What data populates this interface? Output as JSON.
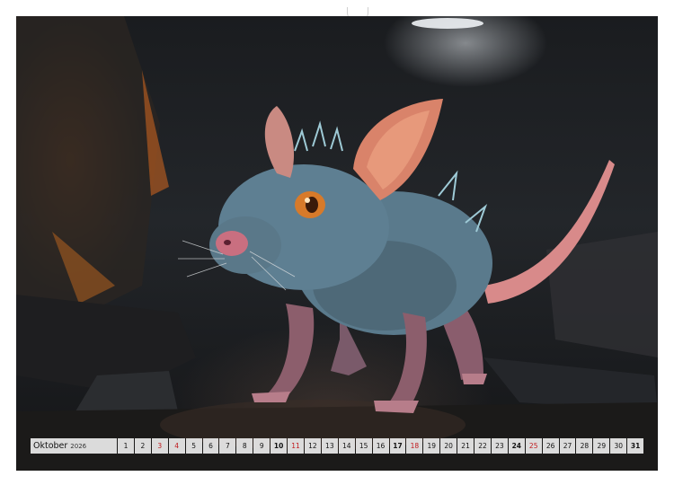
{
  "calendar": {
    "month": "Oktober",
    "year": "2026",
    "days": [
      {
        "d": "1",
        "type": "normal"
      },
      {
        "d": "2",
        "type": "normal"
      },
      {
        "d": "3",
        "type": "holiday"
      },
      {
        "d": "4",
        "type": "holiday"
      },
      {
        "d": "5",
        "type": "normal"
      },
      {
        "d": "6",
        "type": "normal"
      },
      {
        "d": "7",
        "type": "normal"
      },
      {
        "d": "8",
        "type": "normal"
      },
      {
        "d": "9",
        "type": "normal"
      },
      {
        "d": "10",
        "type": "wkend"
      },
      {
        "d": "11",
        "type": "holiday"
      },
      {
        "d": "12",
        "type": "normal"
      },
      {
        "d": "13",
        "type": "normal"
      },
      {
        "d": "14",
        "type": "normal"
      },
      {
        "d": "15",
        "type": "normal"
      },
      {
        "d": "16",
        "type": "normal"
      },
      {
        "d": "17",
        "type": "wkend"
      },
      {
        "d": "18",
        "type": "holiday"
      },
      {
        "d": "19",
        "type": "normal"
      },
      {
        "d": "20",
        "type": "normal"
      },
      {
        "d": "21",
        "type": "normal"
      },
      {
        "d": "22",
        "type": "normal"
      },
      {
        "d": "23",
        "type": "normal"
      },
      {
        "d": "24",
        "type": "wkend"
      },
      {
        "d": "25",
        "type": "holiday"
      },
      {
        "d": "26",
        "type": "normal"
      },
      {
        "d": "27",
        "type": "normal"
      },
      {
        "d": "28",
        "type": "normal"
      },
      {
        "d": "29",
        "type": "normal"
      },
      {
        "d": "30",
        "type": "normal"
      },
      {
        "d": "31",
        "type": "wkend"
      }
    ]
  },
  "colors": {
    "holiday": "#c0181c",
    "creature_skin": "#5a7a8c",
    "ear": "#d9836a",
    "eye": "#d77a2a",
    "tail": "#d88a8a"
  }
}
